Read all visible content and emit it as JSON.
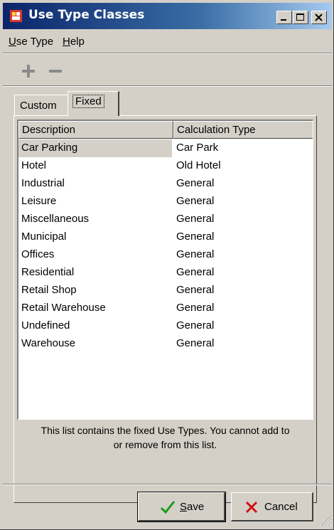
{
  "window": {
    "title": "Use Type Classes",
    "app_icon": "app-icon",
    "controls": [
      "minimize-icon",
      "maximize-icon",
      "close-icon"
    ]
  },
  "menu": {
    "items": [
      {
        "label": "Use Type",
        "underline": "U",
        "rest": "se Type"
      },
      {
        "label": "Help",
        "underline": "H",
        "rest": "elp"
      }
    ]
  },
  "toolbar": {
    "add_icon": "plus-icon",
    "remove_icon": "minus-icon"
  },
  "tabs": [
    {
      "label": "Custom",
      "active": false
    },
    {
      "label": "Fixed",
      "active": true
    }
  ],
  "list": {
    "columns": [
      "Description",
      "Calculation Type"
    ],
    "rows": [
      {
        "description": "Car Parking",
        "calc_type": "Car Park",
        "selected": true
      },
      {
        "description": "Hotel",
        "calc_type": "Old Hotel"
      },
      {
        "description": "Industrial",
        "calc_type": "General"
      },
      {
        "description": "Leisure",
        "calc_type": "General"
      },
      {
        "description": "Miscellaneous",
        "calc_type": "General"
      },
      {
        "description": "Municipal",
        "calc_type": "General"
      },
      {
        "description": "Offices",
        "calc_type": "General"
      },
      {
        "description": "Residential",
        "calc_type": "General"
      },
      {
        "description": "Retail Shop",
        "calc_type": "General"
      },
      {
        "description": "Retail Warehouse",
        "calc_type": "General"
      },
      {
        "description": "Undefined",
        "calc_type": "General"
      },
      {
        "description": "Warehouse",
        "calc_type": "General"
      }
    ]
  },
  "info": {
    "line1": "This list contains the fixed Use Types. You cannot add to",
    "line2": "or remove from this list."
  },
  "buttons": {
    "save": {
      "label": "Save",
      "underline": "S",
      "rest": "ave",
      "icon": "check-icon"
    },
    "cancel": {
      "label": "Cancel",
      "icon": "x-icon"
    }
  },
  "colors": {
    "titlebar_start": "#0a246a",
    "titlebar_end": "#a6caf0",
    "face": "#d4d0c8",
    "check": "#1a9a1a",
    "cancel_x": "#d01010"
  }
}
